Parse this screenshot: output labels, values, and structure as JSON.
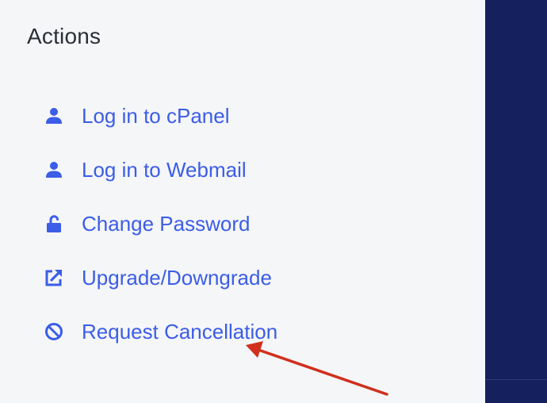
{
  "section": {
    "title": "Actions"
  },
  "actions": [
    {
      "label": "Log in to cPanel",
      "icon": "user-icon"
    },
    {
      "label": "Log in to Webmail",
      "icon": "user-icon"
    },
    {
      "label": "Change Password",
      "icon": "unlock-icon"
    },
    {
      "label": "Upgrade/Downgrade",
      "icon": "external-link-icon"
    },
    {
      "label": "Request Cancellation",
      "icon": "ban-icon"
    }
  ],
  "colors": {
    "panel_background": "#f5f6f8",
    "sidebar_background": "#15205e",
    "link": "#3b5de7",
    "title": "#2b2f36",
    "annotation_arrow": "#d0301c"
  }
}
